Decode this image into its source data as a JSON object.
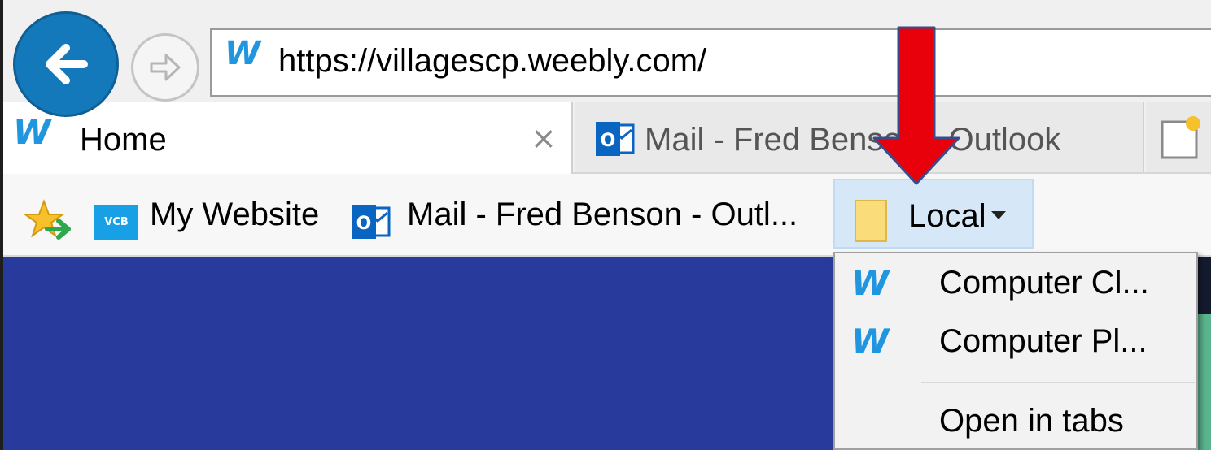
{
  "address_bar": {
    "url": "https://villagescp.weebly.com/",
    "site_icon": "weebly-icon",
    "back_icon": "back-arrow-icon",
    "forward_icon": "forward-arrow-icon"
  },
  "tabs": [
    {
      "label": "Home",
      "icon": "weebly-icon",
      "close": "×",
      "active": true
    },
    {
      "label": "Mail - Fred Benson - Outlook",
      "icon": "outlook-icon",
      "active": false
    }
  ],
  "favorites_bar": {
    "items": [
      {
        "label": "My Website",
        "icon": "vcb-icon",
        "icon_text": "VCB"
      },
      {
        "label": "Mail - Fred Benson - Outl...",
        "icon": "outlook-icon"
      },
      {
        "label": "Local",
        "icon": "folder-icon"
      }
    ]
  },
  "local_dropdown": {
    "items": [
      {
        "label": "Computer Cl...",
        "icon": "weebly-icon"
      },
      {
        "label": "Computer Pl...",
        "icon": "weebly-icon"
      }
    ],
    "open_in_tabs": "Open in tabs"
  },
  "colors": {
    "accent_blue": "#1479bb",
    "page_background": "#283b9c",
    "annotation_arrow": "#e8000a"
  },
  "annotation": {
    "icon": "red-down-arrow"
  }
}
